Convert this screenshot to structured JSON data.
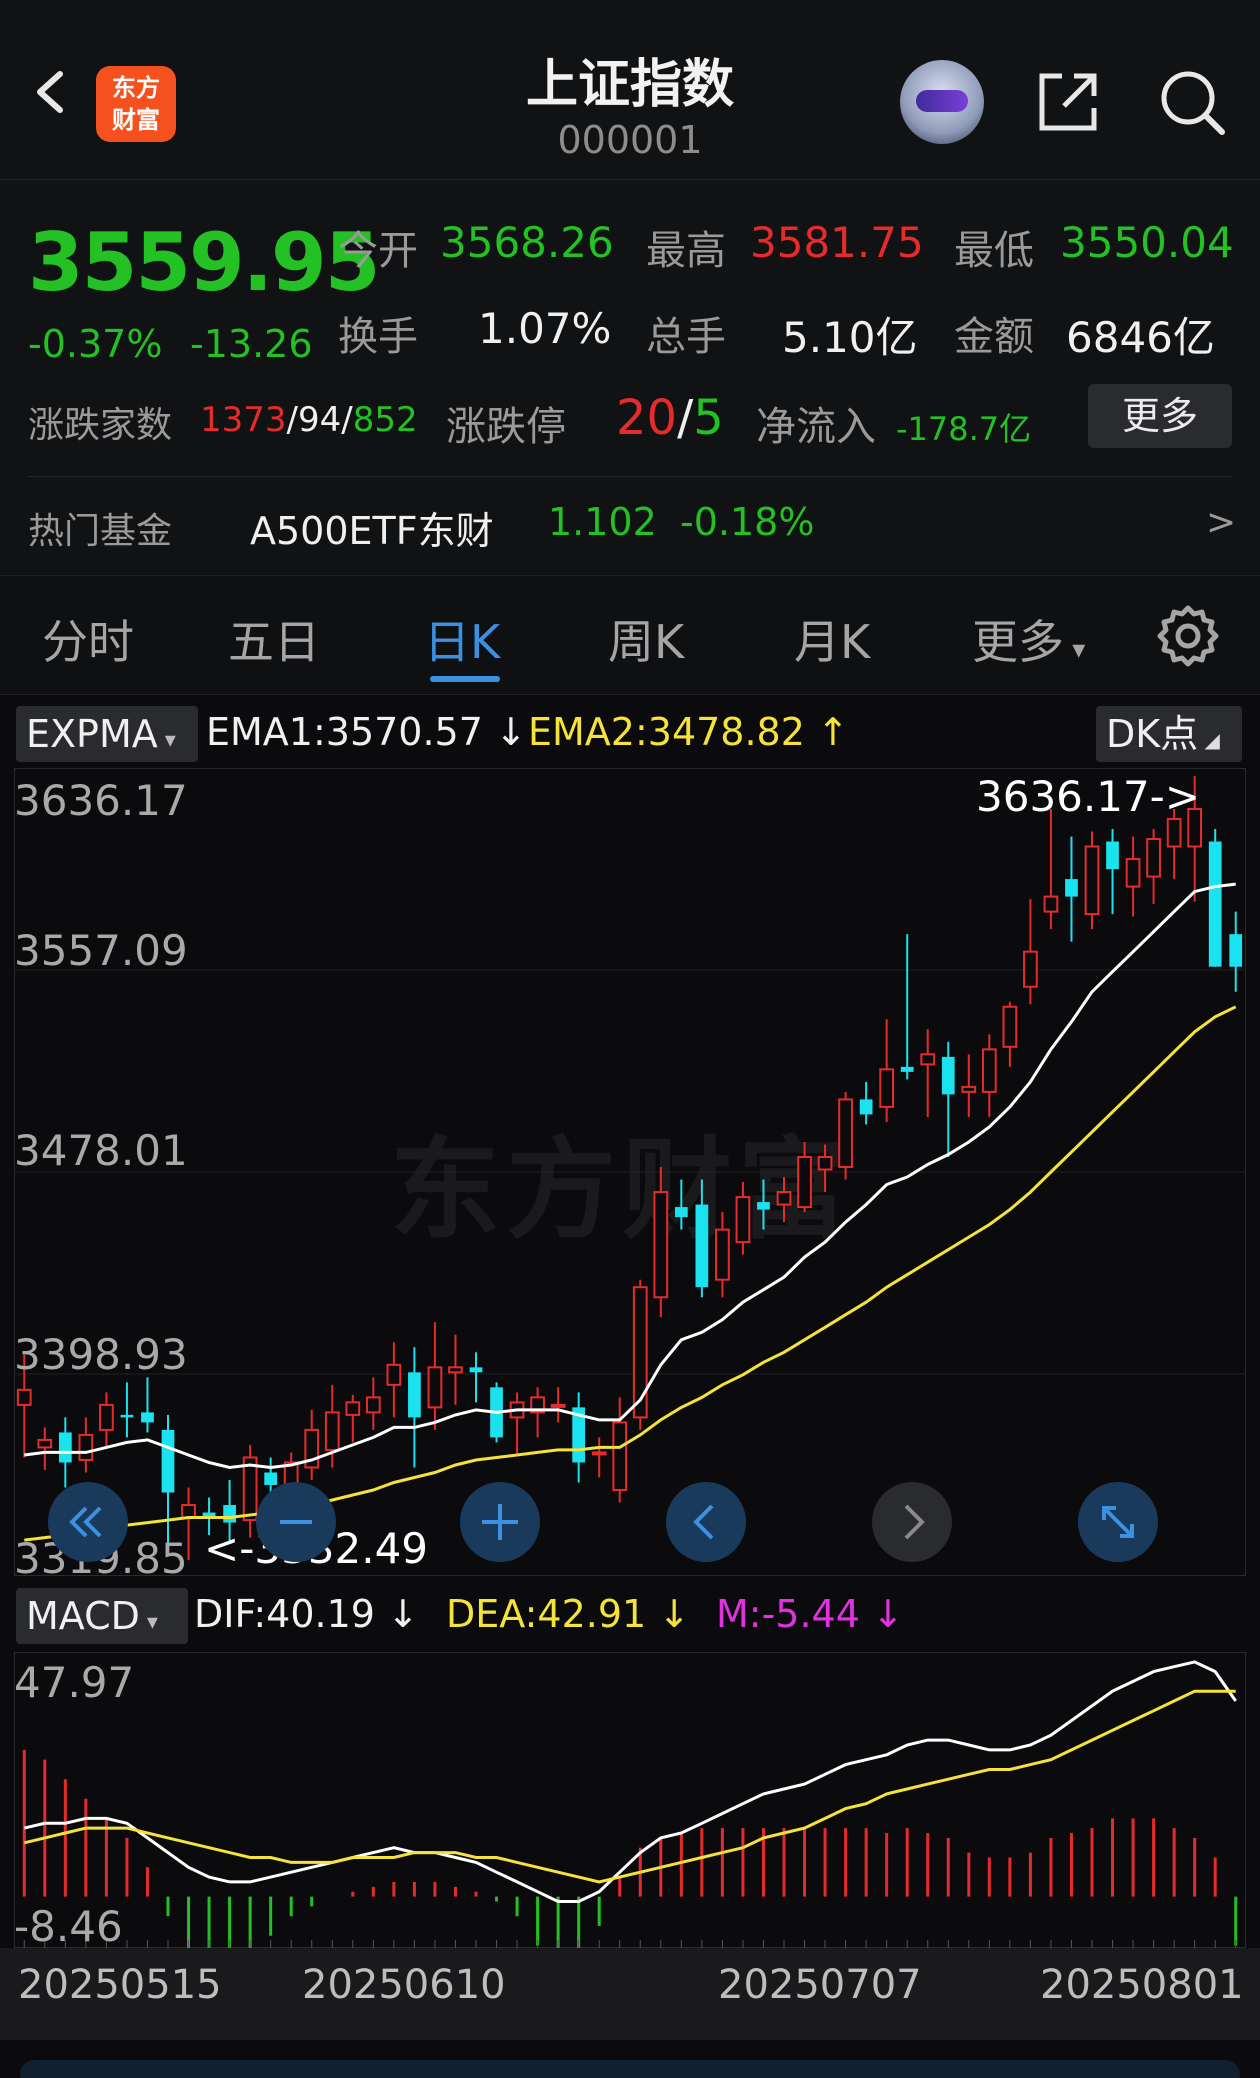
{
  "header": {
    "title": "上证指数",
    "code": "000001",
    "logo_text_1": "东方",
    "logo_text_2": "财富"
  },
  "quote": {
    "price": "3559.95",
    "change_pct": "-0.37%",
    "change": "-13.26",
    "open_label": "今开",
    "open": "3568.26",
    "high_label": "最高",
    "high": "3581.75",
    "low_label": "最低",
    "low": "3550.04",
    "turnover_label": "换手",
    "turnover": "1.07%",
    "volume_label": "总手",
    "volume": "5.10亿",
    "amount_label": "金额",
    "amount": "6846亿",
    "breadth_label": "涨跌家数",
    "up_count": "1373",
    "flat_count": "94",
    "down_count": "852",
    "limit_label": "涨跌停",
    "limit_up": "20",
    "limit_down": "5",
    "netflow_label": "净流入",
    "netflow": "-178.7亿",
    "more_label": "更多",
    "fund_label": "热门基金",
    "fund_name": "A500ETF东财",
    "fund_price": "1.102",
    "fund_change": "-0.18%",
    "fund_arrow": ">"
  },
  "tabs": [
    "分时",
    "五日",
    "日K",
    "周K",
    "月K",
    "更多"
  ],
  "active_tab": "日K",
  "main_indicator": {
    "selector": "EXPMA",
    "ema1_label": "EMA1:3570.57 ↓",
    "ema2_label": "EMA2:3478.82 ↑",
    "dk_label": "DK点",
    "colors": {
      "ema1": "#ffffff",
      "ema2": "#f5e23a",
      "up": "#e62b2b",
      "down": "#1be2ef"
    }
  },
  "sub_indicator": {
    "selector": "MACD",
    "dif_label": "DIF:40.19 ↓",
    "dea_label": "DEA:42.91 ↓",
    "m_label": "M:-5.44 ↓",
    "colors": {
      "dif": "#ffffff",
      "dea": "#f5e23a",
      "m": "#e032e0"
    }
  },
  "watermark": "东方财富",
  "chart_data": [
    {
      "type": "candlestick",
      "y_ticks": [
        "3636.17",
        "3557.09",
        "3478.01",
        "3398.93",
        "3319.85"
      ],
      "ylim": [
        3319.85,
        3636.17
      ],
      "max_annotation": "3636.17->",
      "min_annotation": "<-3332.49",
      "x_ticks": [
        "20250515",
        "20250610",
        "20250707",
        "20250801"
      ],
      "candles": [
        [
          3385,
          3405,
          3364,
          3391
        ],
        [
          3368,
          3376,
          3359,
          3371
        ],
        [
          3374,
          3380,
          3352,
          3362
        ],
        [
          3363,
          3380,
          3358,
          3373
        ],
        [
          3375,
          3390,
          3368,
          3385
        ],
        [
          3381,
          3394,
          3372,
          3380
        ],
        [
          3382,
          3396,
          3374,
          3378
        ],
        [
          3375,
          3381,
          3325,
          3350
        ],
        [
          3340,
          3352,
          3323,
          3345
        ],
        [
          3342,
          3348,
          3333,
          3340
        ],
        [
          3345,
          3355,
          3330,
          3338
        ],
        [
          3339,
          3369,
          3332,
          3364
        ],
        [
          3358,
          3364,
          3338,
          3353
        ],
        [
          3346,
          3366,
          3340,
          3362
        ],
        [
          3360,
          3383,
          3355,
          3375
        ],
        [
          3367,
          3393,
          3360,
          3382
        ],
        [
          3381,
          3389,
          3370,
          3386
        ],
        [
          3382,
          3396,
          3375,
          3388
        ],
        [
          3393,
          3410,
          3380,
          3401
        ],
        [
          3398,
          3408,
          3360,
          3380
        ],
        [
          3384,
          3418,
          3375,
          3400
        ],
        [
          3398,
          3413,
          3385,
          3400
        ],
        [
          3400,
          3406,
          3386,
          3398
        ],
        [
          3392,
          3394,
          3370,
          3372
        ],
        [
          3380,
          3390,
          3365,
          3386
        ],
        [
          3382,
          3392,
          3372,
          3388
        ],
        [
          3385,
          3392,
          3378,
          3385
        ],
        [
          3384,
          3390,
          3354,
          3362
        ],
        [
          3366,
          3372,
          3356,
          3366
        ],
        [
          3351,
          3388,
          3346,
          3378
        ],
        [
          3380,
          3435,
          3375,
          3432
        ],
        [
          3428,
          3480,
          3420,
          3470
        ],
        [
          3464,
          3475,
          3455,
          3460
        ],
        [
          3465,
          3475,
          3428,
          3432
        ],
        [
          3435,
          3462,
          3428,
          3455
        ],
        [
          3450,
          3474,
          3445,
          3468
        ],
        [
          3466,
          3475,
          3455,
          3463
        ],
        [
          3465,
          3476,
          3458,
          3470
        ],
        [
          3464,
          3490,
          3462,
          3484
        ],
        [
          3479,
          3489,
          3470,
          3484
        ],
        [
          3480,
          3510,
          3475,
          3507
        ],
        [
          3507,
          3514,
          3497,
          3501
        ],
        [
          3504,
          3539,
          3498,
          3519
        ],
        [
          3520,
          3573,
          3515,
          3518
        ],
        [
          3521,
          3535,
          3500,
          3525
        ],
        [
          3524,
          3530,
          3484,
          3509
        ],
        [
          3510,
          3525,
          3500,
          3512
        ],
        [
          3510,
          3533,
          3500,
          3527
        ],
        [
          3528,
          3546,
          3520,
          3544
        ],
        [
          3552,
          3587,
          3545,
          3566
        ],
        [
          3582,
          3623,
          3575,
          3588
        ],
        [
          3595,
          3612,
          3570,
          3588
        ],
        [
          3581,
          3614,
          3575,
          3608
        ],
        [
          3610,
          3615,
          3581,
          3599
        ],
        [
          3592,
          3612,
          3580,
          3603
        ],
        [
          3596,
          3615,
          3585,
          3611
        ],
        [
          3608,
          3623,
          3595,
          3619
        ],
        [
          3608,
          3636.17,
          3586,
          3623
        ],
        [
          3610,
          3615,
          3560,
          3560
        ],
        [
          3573,
          3582,
          3550,
          3560
        ]
      ],
      "ema1": [
        3365,
        3366,
        3366,
        3366,
        3368,
        3370,
        3371,
        3368,
        3365,
        3362,
        3360,
        3361,
        3360,
        3361,
        3363,
        3366,
        3369,
        3372,
        3376,
        3376,
        3378,
        3381,
        3383,
        3382,
        3383,
        3383,
        3383,
        3381,
        3379,
        3379,
        3387,
        3401,
        3411,
        3414,
        3419,
        3426,
        3431,
        3436,
        3444,
        3450,
        3458,
        3465,
        3473,
        3476,
        3481,
        3485,
        3490,
        3496,
        3504,
        3514,
        3527,
        3538,
        3550,
        3558,
        3566,
        3574,
        3582,
        3590,
        3592,
        3593
      ],
      "ema2": [
        3331,
        3332,
        3333,
        3334,
        3335,
        3337,
        3338,
        3339,
        3340,
        3340,
        3340,
        3341,
        3342,
        3343,
        3345,
        3347,
        3349,
        3351,
        3354,
        3356,
        3358,
        3361,
        3363,
        3364,
        3365,
        3366,
        3367,
        3367,
        3368,
        3368,
        3373,
        3379,
        3384,
        3388,
        3393,
        3397,
        3402,
        3406,
        3411,
        3416,
        3421,
        3426,
        3432,
        3437,
        3442,
        3447,
        3452,
        3457,
        3463,
        3470,
        3478,
        3486,
        3494,
        3502,
        3510,
        3518,
        3526,
        3534,
        3540,
        3544
      ]
    },
    {
      "type": "macd",
      "y_ticks": [
        "47.97",
        "-8.46"
      ],
      "ylim": [
        -8.46,
        47.97
      ],
      "dif": [
        14,
        15,
        15,
        16,
        16,
        15,
        12,
        9,
        6,
        4,
        3,
        3,
        4,
        5,
        6,
        7,
        8,
        9,
        10,
        9,
        9,
        8,
        7,
        5,
        3,
        1,
        -1,
        -1,
        1,
        5,
        9,
        12,
        13,
        15,
        17,
        19,
        21,
        22,
        23,
        25,
        27,
        28,
        29,
        31,
        32,
        32,
        31,
        30,
        30,
        31,
        33,
        36,
        39,
        42,
        44,
        46,
        47,
        48,
        46,
        40
      ],
      "dea": [
        11,
        12,
        13,
        14,
        14,
        14,
        13,
        12,
        11,
        10,
        9,
        8,
        8,
        7,
        7,
        7,
        8,
        8,
        8,
        9,
        9,
        9,
        8,
        8,
        7,
        6,
        5,
        4,
        3,
        4,
        5,
        6,
        7,
        8,
        9,
        10,
        12,
        13,
        14,
        16,
        18,
        19,
        21,
        22,
        23,
        24,
        25,
        26,
        26,
        27,
        28,
        30,
        32,
        34,
        36,
        38,
        40,
        42,
        42,
        42
      ],
      "m": [
        30,
        28,
        24,
        20,
        16,
        12,
        6,
        -4,
        -12,
        -14,
        -14,
        -12,
        -8,
        -4,
        -2,
        0,
        1,
        2,
        3,
        3,
        3,
        2,
        1,
        -1,
        -4,
        -10,
        -14,
        -12,
        -6,
        4,
        10,
        12,
        13,
        14,
        14,
        14,
        14,
        14,
        14,
        14,
        14,
        14,
        13,
        14,
        13,
        12,
        9,
        8,
        8,
        9,
        12,
        13,
        14,
        16,
        16,
        16,
        14,
        12,
        8,
        -10
      ]
    }
  ]
}
